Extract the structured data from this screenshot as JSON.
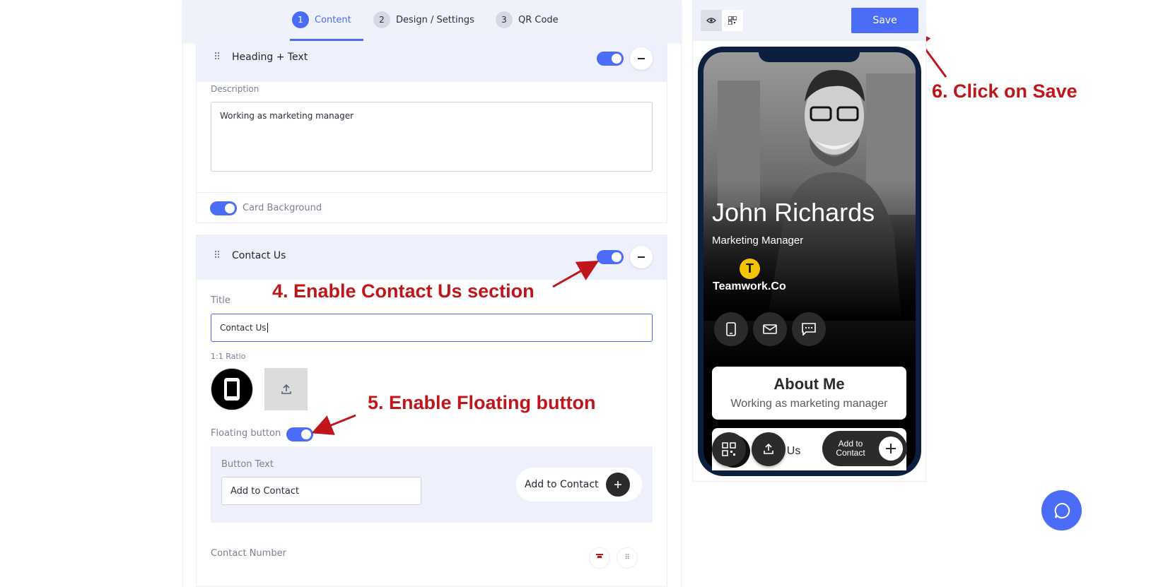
{
  "steps": [
    {
      "num": "1",
      "label": "Content"
    },
    {
      "num": "2",
      "label": "Design / Settings"
    },
    {
      "num": "3",
      "label": "QR Code"
    }
  ],
  "heading_section": {
    "title": "Heading + Text",
    "description_label": "Description",
    "description_value": "Working as marketing manager",
    "card_background_label": "Card Background"
  },
  "contact_section": {
    "title": "Contact Us",
    "title_label": "Title",
    "title_value": "Contact Us",
    "ratio_label": "1:1 Ratio",
    "floating_label": "Floating button",
    "button_text_label": "Button Text",
    "button_text_value": "Add to Contact",
    "button_preview_label": "Add to Contact",
    "contact_number_label": "Contact Number"
  },
  "annotations": {
    "step4": "4. Enable Contact Us section",
    "step5": "5. Enable Floating button",
    "step6": "6. Click on Save"
  },
  "preview": {
    "save_label": "Save",
    "name": "John Richards",
    "role": "Marketing Manager",
    "company": "Teamwork.Co",
    "logo_letter": "T",
    "about_title": "About Me",
    "about_text": "Working as marketing manager",
    "contact_partial": "act Us",
    "add_to_contact_line1": "Add to",
    "add_to_contact_line2": "Contact"
  },
  "colors": {
    "accent": "#4a6cf7",
    "annotation": "#c0161b",
    "phone_frame": "#0d1e3f",
    "logo_yellow": "#f5c400"
  }
}
